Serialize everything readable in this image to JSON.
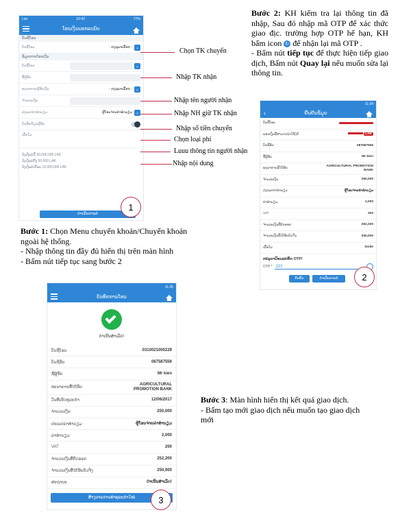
{
  "phone1": {
    "status_left": "Lao",
    "status_time": "10:42",
    "status_right": "77%",
    "title": "ໂອນເງິນນອກລະບົບ",
    "section_from": "ບັນຊີໂອນ",
    "from_account_label": "ບັນຊີໂອນ",
    "from_account_value": "- ກະລຸນາເລືອກ -",
    "section_to": "ຂໍ້ມູນການໂອນເງິນ",
    "fields": [
      {
        "label": "ບັນຊີໂອນ"
      },
      {
        "label": "ຊື່ຜູ້ຮັບ"
      },
      {
        "label": "ທະນາຄານຜູ້ຮັບເງິນ",
        "value": "- ກະລຸນາເລືອກ -"
      },
      {
        "label": "ຈຳນວນເງິນ"
      },
      {
        "label": "ປະເພດຄ່າທຳນຽມ",
        "value": "ຜູ້ໂອນຈ່າຍຄ່າທຳນຽມ"
      },
      {
        "label": "ບັນທຶກຂໍ້ມູນຜູ້ຮັບ"
      },
      {
        "label": "ເນື້ອໃນ"
      }
    ],
    "limits": [
      "ວົງເງິນຕໍ່ມື້ 30,000,000 LAK",
      "ວົງເງິນຕໍ່ຄັ້ງ 50,000 LAK",
      "ວົງເງິນຕໍ່ເດືອນ 10,000,000 LAK"
    ],
    "continue_button": "ດຳເນີນການຕໍ່",
    "step_number": "1"
  },
  "annotations": [
    "Chọn TK chuyển",
    "Nhập TK nhận",
    "Nhập tên người nhận",
    "Nhập NH giữ TK nhận",
    "Nhập số tiền chuyển",
    "Chọn loại phí",
    "Luuu thông tin người nhận",
    "Nhập nội dung"
  ],
  "step1": {
    "title": "Bước 1:",
    "text": " Chọn Menu chuyển khoản/Chuyển khoản ngoài hệ thống.",
    "bullet1": "- Nhập thông tin đầy đủ hiển thị trên màn hình",
    "bullet2": "- Bấm nút tiếp tục sang bước 2"
  },
  "step2": {
    "title": "Bước 2:",
    "text1": " KH kiểm tra lại thông tin đã nhập, Sau đó nhập mã OTP để xác thức giao địc. trường hợp  OTP hế hạn, KH bấm icon",
    "text2": " để nhận lại mã OTP .",
    "bullet_a": "- Bấm nút ",
    "bullet_bold1": "tiếp tục",
    "bullet_b": " để thực hiện tiếp giao dịch, Bấm nút ",
    "bullet_bold2": "Quay lại",
    "bullet_c": " nếu muốn sửa lại thông tin."
  },
  "phone2": {
    "status_time": "11:34",
    "title": "ຢືນຢັນຂໍ້ມູນ",
    "rows": [
      {
        "label": "ບັນຊີໂອນ",
        "value": ""
      },
      {
        "label": "ຍອດເງິນທີ່ສາມາດນຳໃຊ້ໄດ້",
        "value": "LAK"
      },
      {
        "label": "ບັນຊີຮັບ",
        "value": "087587556"
      },
      {
        "label": "ຊື່ຜູ້ຮັບ",
        "value": "Mr kien"
      },
      {
        "label": "ທະນາຄານທີ່ໄດ້ຮັບ",
        "value": "AGRICULTURAL PROMOTION BANK"
      },
      {
        "label": "ຈຳນວນເງິນ",
        "value": "250,000"
      },
      {
        "label": "ປະເພດຄ່າທຳນຽມ",
        "value": "ຜູ້ໂອນຈ່າຍຄ່າທຳນຽມ"
      },
      {
        "label": "ຄ່າທຳນຽມ",
        "value": "2,000"
      },
      {
        "label": "VAT",
        "value": "200"
      },
      {
        "label": "ຈຳນວນເງິນທີ່ຕັດອອກ",
        "value": "252,200"
      },
      {
        "label": "ຈຳນວນເງິນທີ່ໄດ້ຮັບຕົວຈິງ",
        "value": "250,000"
      },
      {
        "label": "ເນື້ອໃນ",
        "value": "Smile"
      }
    ],
    "otp_prompt": "ກະລຸນາປ້ອນລະຫັດ OTP!",
    "otp_label": "OTP *",
    "otp_value": "222",
    "back_button": "ກັບຄືນ",
    "continue_button": "ດຳເນີນການຕໍ່",
    "step_number": "2"
  },
  "phone3": {
    "status_time": "11:35",
    "title": "ບັນທຶກການໂອນ",
    "success_text": "ດຳເນີນສຳເລັດ!",
    "rows": [
      {
        "label": "ບັນຊີໂອນ",
        "value": "0310021000229"
      },
      {
        "label": "ບັນຊີຮັບ",
        "value": "087587556"
      },
      {
        "label": "ຊື່ຜູ້ຮັບ",
        "value": "Mr kien"
      },
      {
        "label": "ທະນາຄານທີ່ໄດ້ຮັບ",
        "value": "AGRICULTURAL PROMOTION BANK"
      },
      {
        "label": "ວັນທີເຮັດທຸລະກຳ",
        "value": "12/06/2017"
      },
      {
        "label": "ຈຳນວນເງິນ",
        "value": "250,000"
      },
      {
        "label": "ປະເພດຄ່າທຳນຽມ",
        "value": "ຜູ້ໂອນຈ່າຍຄ່າທຳນຽມ"
      },
      {
        "label": "ຄ່າທຳນຽມ",
        "value": "2,000"
      },
      {
        "label": "VAT",
        "value": "200"
      },
      {
        "label": "ຈຳນວນເງິນທີ່ຕັດອອກ",
        "value": "252,200"
      },
      {
        "label": "ຈຳນວນເງິນທີ່ໄດ້ຮັບຕົວຈິງ",
        "value": "250,000"
      },
      {
        "label": "ສະຖານະ",
        "value": "ດຳເນີນສຳເລັດ!"
      }
    ],
    "new_button": "ສ້າງລາຍການທຳທຸລະກຳໃໝ່",
    "step_number": "3"
  },
  "step3": {
    "title": "Bước 3",
    "text": ": Màn hình hiển thị kết quả giao dịch.",
    "bullet": "-  Bấm tạo mới giao dịch nếu muốn tạo giao dịch mới"
  },
  "colors": {
    "primary": "#2f86d6",
    "accent_red": "#c0304a",
    "success": "#22b14c"
  }
}
